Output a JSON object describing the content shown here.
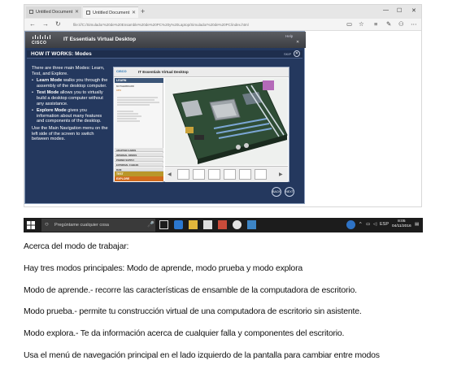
{
  "browser": {
    "tabs": [
      {
        "label": "Untitled Document"
      },
      {
        "label": "Untitled Document"
      }
    ],
    "new_tab_icon": "plus-icon",
    "url": "file:///C:/Simulador%20de%20Ensamble%20de%20PC%20y%20Laptop/Simulador%20de%20PC/index.html",
    "window_controls": [
      "minimize-icon",
      "maximize-icon",
      "close-icon"
    ]
  },
  "app": {
    "logo_text": "CISCO",
    "title": "IT Essentials Virtual Desktop",
    "help_label": "Help",
    "section_title": "HOW IT WORKS: Modes",
    "skip_label": "SKIP",
    "intro": "There are three main Modes: Learn, Test, and Explore.",
    "modes": [
      {
        "name": "Learn Mode",
        "desc": "walks you through the assembly of the desktop computer."
      },
      {
        "name": "Test Mode",
        "desc": "allows you to virtually build a desktop computer without any assistance."
      },
      {
        "name": "Explore Mode",
        "desc": "gives you information about many features and components of the desktop."
      }
    ],
    "outro": "Use the Main Navigation menu on the left side of the screen to switch between modes.",
    "inner": {
      "logo": "CISCO",
      "title": "IT Essentials Virtual Desktop",
      "menu_learn": "LEARN",
      "menu_sub1": "MOTHERBOARD",
      "menu_sub2": "CPU",
      "menu_items": [
        "ADAPTER CARDS",
        "INTERNAL DRIVES",
        "POWER SUPPLY",
        "EXTERNAL CABLES",
        "RAM"
      ],
      "menu_test": "TEST",
      "menu_explore": "EXPLORE"
    },
    "buttons": [
      "BACK",
      "NEXT"
    ]
  },
  "taskbar": {
    "search_placeholder": "Pregúntame cualquier cosa",
    "language": "ESP",
    "time": "8:05",
    "date": "04/11/2016"
  },
  "doc": {
    "lines": [
      "Acerca del modo de trabajar:",
      "Hay tres modos principales:  Modo de aprende, modo prueba y modo explora",
      "Modo de aprende.- recorre las características de ensamble de la computadora de escritorio.",
      "Modo prueba.- permite tu construcción virtual de una computadora de escritorio sin asistente.",
      "Modo explora.-  Te da información acerca de cualquier falla y componentes del escritorio.",
      "Usa el menú de navegación principal en el lado izquierdo de la pantalla para cambiar entre modos"
    ]
  },
  "colors": {
    "app_background": "#24385e",
    "taskbar": "#1c1c1c",
    "menu_test": "#b9962a",
    "menu_explore": "#d16a1d"
  }
}
